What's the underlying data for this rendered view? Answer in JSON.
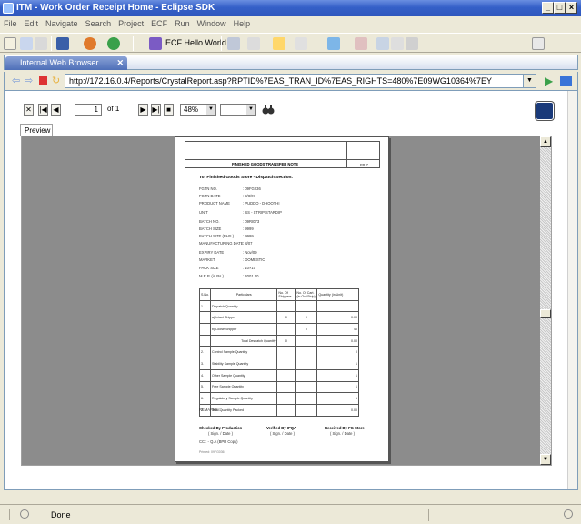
{
  "window": {
    "title": "ITM - Work Order Receipt Home - Eclipse SDK",
    "controls": [
      "_",
      "□",
      "×"
    ]
  },
  "menu": [
    "File",
    "Edit",
    "Navigate",
    "Search",
    "Project",
    "ECF",
    "Run",
    "Window",
    "Help"
  ],
  "toolbar": {
    "hello_label": "ECF Hello World"
  },
  "view_tab": {
    "title": "Internal Web Browser"
  },
  "address": {
    "url": "http://172.16.0.4/Reports/CrystalReport.asp?RPTID%7EAS_TRAN_ID%7EAS_RIGHTS=480%7E09WG10364%7EY"
  },
  "crystal": {
    "page_current": "1",
    "page_of": "of 1",
    "zoom": "48%",
    "preview_tab": "Preview"
  },
  "report": {
    "title": "FINISHED GOODS TRANSFER NOTE",
    "code": "FP 7",
    "to_line": "To: Finished Goods Store - Dispatch Section.",
    "fields": [
      {
        "label": "FGTN NO.",
        "value": ": 09FG036"
      },
      {
        "label": "FGTN DATE",
        "value": ": 9/8/07"
      },
      {
        "label": "PRODUCT NAME",
        "value": ": PUDDO  -  DHOOTHI"
      },
      {
        "label": "UNIT",
        "value": ": SS  -  STRIP STARDIP"
      },
      {
        "label": "BATCH NO.",
        "value": ": 09RI073"
      },
      {
        "label": "BATCH SIZE",
        "value": ": 9999"
      },
      {
        "label": "BATCH SIZE (PHS.)",
        "value": ": 9999"
      },
      {
        "label": "MANUFACTURING DATE",
        "value": ": 8/07"
      },
      {
        "label": "EXPIRY DATE",
        "value": ": Nov/09"
      },
      {
        "label": "MARKET",
        "value": ": DOMESTIC"
      },
      {
        "label": "PACK SIZE",
        "value": ": 10×10"
      },
      {
        "label": "M.R.P. (in Rs.)",
        "value": ": 4001.40"
      }
    ],
    "table_head": [
      "S.No.",
      "Particulars",
      "No. Of Shippers",
      "No. Of Cart. (in Out/Strip)",
      "Quantity (in Unit)"
    ],
    "rows": [
      {
        "sno": "1.",
        "part": "Dispatch Quantity",
        "ship": "",
        "cart": "",
        "qty": ""
      },
      {
        "sno": "",
        "part": "a) Intact Shipper",
        "ship": "0",
        "cart": "0",
        "qty": "0.00"
      },
      {
        "sno": "",
        "part": "b) Loose Shipper",
        "ship": "",
        "cart": "0",
        "qty": "40"
      },
      {
        "sno": "",
        "part": "Total Despatch Quantity",
        "ship": "0",
        "cart": "",
        "qty": "0.00"
      },
      {
        "sno": "2.",
        "part": "Control Sample Quantity",
        "ship": "",
        "cart": "",
        "qty": "0"
      },
      {
        "sno": "3.",
        "part": "Stability Sample Quantity",
        "ship": "",
        "cart": "",
        "qty": "1"
      },
      {
        "sno": "4.",
        "part": "Other Sample Quantity",
        "ship": "",
        "cart": "",
        "qty": "1"
      },
      {
        "sno": "5.",
        "part": "Free Sample Quantity",
        "ship": "",
        "cart": "",
        "qty": "1"
      },
      {
        "sno": "6.",
        "part": "Regulatory Sample Quantity",
        "ship": "",
        "cart": "",
        "qty": "1"
      },
      {
        "sno": "7.",
        "part": "Total Quantity Packed",
        "ship": "",
        "cart": "",
        "qty": "0.00"
      }
    ],
    "remarks": "REMARKS          :",
    "signatures": [
      {
        "role": "Checked By Production",
        "sub": "( Sign. / Date )"
      },
      {
        "role": "Verified By IPQA",
        "sub": "( Sign. / Date )"
      },
      {
        "role": "Received By FG Store",
        "sub": "( Sign. / Date )"
      }
    ],
    "cc_line": "CC : - Q.A (BPR Copy)",
    "footer": "Printed: 09FG036"
  },
  "status": {
    "text": "Done"
  }
}
